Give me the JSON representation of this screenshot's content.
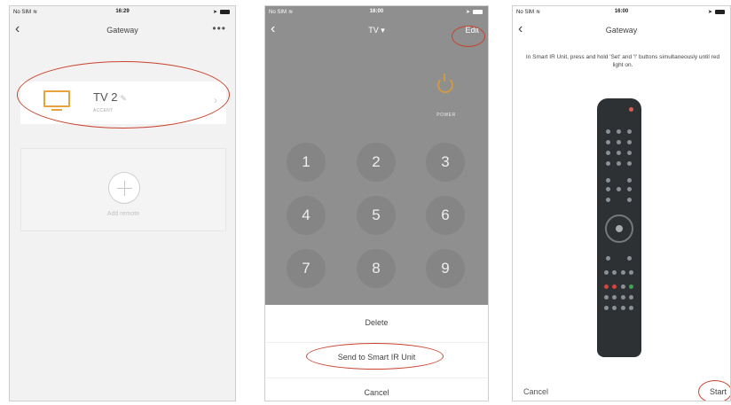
{
  "panel1": {
    "status": {
      "carrier": "No SIM",
      "time": "16:29"
    },
    "nav": {
      "title": "Gateway",
      "more": "•••"
    },
    "remote": {
      "name": "TV 2",
      "brand": "ACCENT"
    },
    "add_label": "Add remote"
  },
  "panel2": {
    "status": {
      "carrier": "No SIM",
      "time": "16:00"
    },
    "nav": {
      "title": "TV",
      "edit_label": "Edit"
    },
    "power_label": "POWER",
    "keys": [
      "1",
      "2",
      "3",
      "4",
      "5",
      "6",
      "7",
      "8",
      "9"
    ],
    "sheet": {
      "delete": "Delete",
      "send": "Send to Smart IR Unit",
      "cancel": "Cancel"
    }
  },
  "panel3": {
    "status": {
      "carrier": "No SIM",
      "time": "16:00"
    },
    "nav": {
      "title": "Gateway"
    },
    "instruction": "In Smart IR Unit, press and hold 'Set' and '!' buttons simultaneously until red light on.",
    "cancel_label": "Cancel",
    "start_label": "Start"
  },
  "colors": {
    "accent": "#e8a33c",
    "highlight_oval": "#c8432e",
    "overlay": "#8f8f8f"
  }
}
